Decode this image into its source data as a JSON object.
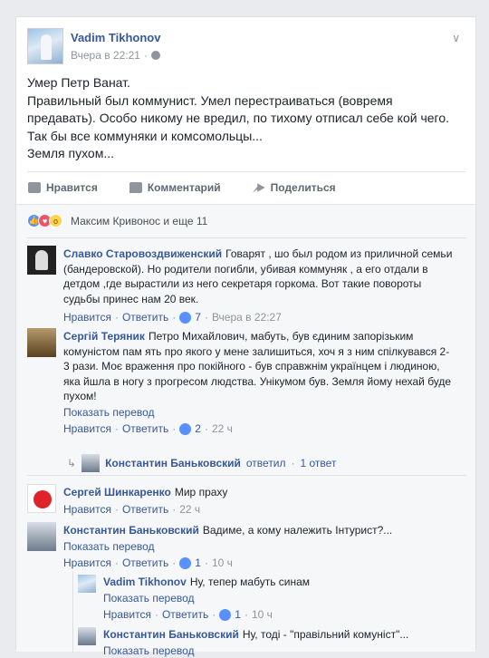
{
  "post": {
    "author": "Vadim Tikhonov",
    "time": "Вчера в 22:21",
    "lines": [
      "Умер Петр Ванат.",
      "Правильный был коммунист. Умел перестраиваться (вовремя",
      "предавать). Особо никому не вредил, по тихому отписал себе кой чего.",
      "Так бы все коммуняки и комсомольцы...",
      "Земля пухом..."
    ],
    "actions": {
      "like": "Нравится",
      "comment": "Комментарий",
      "share": "Поделиться"
    }
  },
  "reactions": {
    "text": "Максим Кривонос и еще 11"
  },
  "comments": [
    {
      "name": "Славко Старовоздвиженский",
      "lines": [
        "Говарят , шо был родом из приличной семьи",
        "(бандеровской). Но родители погибли, убивая коммуняк , а его отдали в",
        "детдом ,где вырастили из него секретаря горкома. Вот такие повороты",
        "судьбы принес нам 20 век."
      ],
      "like": "Нравится",
      "reply": "Ответить",
      "likes": "7",
      "time": "Вчера в 22:27"
    },
    {
      "name": "Сергій Теряник",
      "lines": [
        "Петро Михайлович, мабуть, був єдиним запорізьким",
        "комуністом пам ять про якого у мене залишиться, хоч я з ним спілкувався 2-",
        "3 рази. Моє враження про покійного - був справжнім українцем і людиною,",
        "яка йшла в ногу з прогресом людства. Унікумом був. Земля йому нехай буде",
        "пухом!"
      ],
      "translate": "Показать перевод",
      "like": "Нравится",
      "reply": "Ответить",
      "likes": "2",
      "time": "22 ч",
      "replies_link": {
        "name": "Константин Баньковский",
        "text": "ответил",
        "count": "1 ответ"
      }
    },
    {
      "name": "Сергей Шинкаренко",
      "lines": [
        "Мир праху"
      ],
      "like": "Нравится",
      "reply": "Ответить",
      "time": "22 ч"
    },
    {
      "name": "Константин Баньковский",
      "lines": [
        "Вадиме, а кому належить Інтурист?..."
      ],
      "translate": "Показать перевод",
      "like": "Нравится",
      "reply": "Ответить",
      "likes": "1",
      "time": "10 ч"
    }
  ],
  "nested": [
    {
      "name": "Vadim Tikhonov",
      "text": "Ну, тепер мабуть синам",
      "translate": "Показать перевод",
      "like": "Нравится",
      "reply": "Ответить",
      "likes": "1",
      "time": "10 ч"
    },
    {
      "name": "Константин Баньковский",
      "text": "Ну, тоді - \"правільний комуніст\"...",
      "translate": "Показать перевод"
    }
  ],
  "separator": "·"
}
